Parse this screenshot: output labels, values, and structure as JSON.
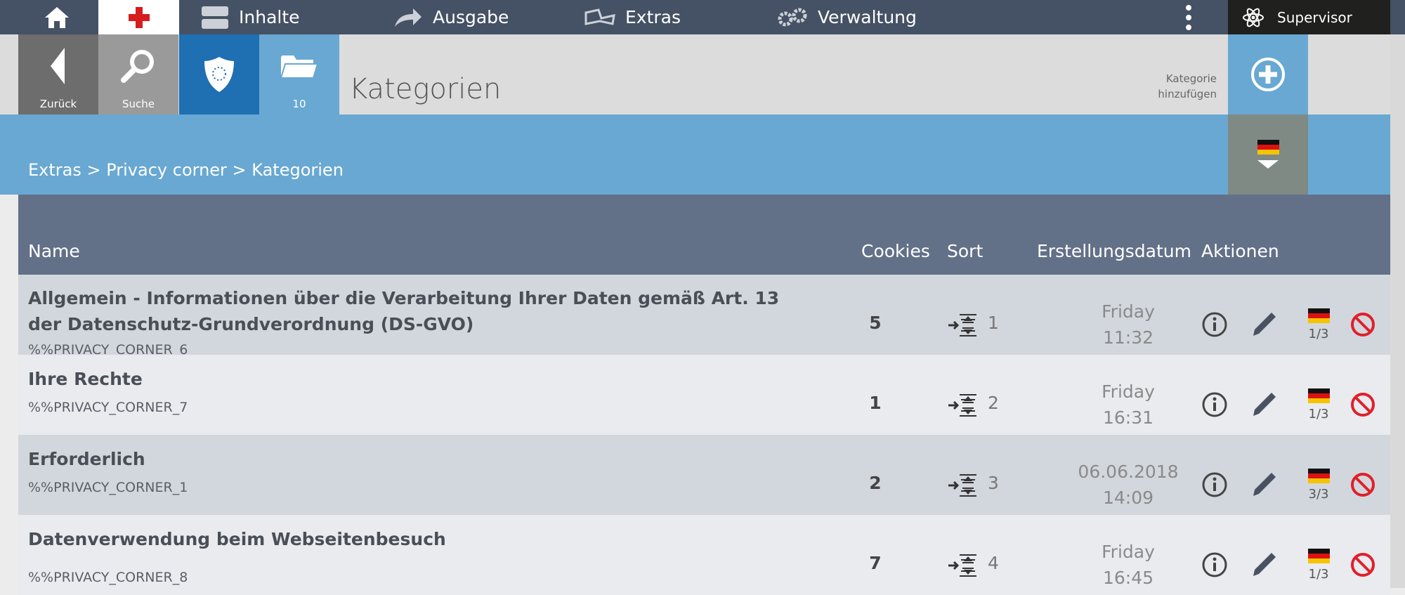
{
  "nav": {
    "items": [
      {
        "label": "Inhalte"
      },
      {
        "label": "Ausgabe"
      },
      {
        "label": "Extras"
      },
      {
        "label": "Verwaltung"
      }
    ],
    "user": "Supervisor"
  },
  "toolbar": {
    "back_label": "Zurück",
    "search_label": "Suche",
    "folder_count": "10",
    "page_title": "Kategorien",
    "add_label": "Kategorie hinzufügen"
  },
  "breadcrumb": "Extras > Privacy corner > Kategorien",
  "table": {
    "headers": {
      "name": "Name",
      "cookies": "Cookies",
      "sort": "Sort",
      "date": "Erstellungsdatum",
      "actions": "Aktionen"
    },
    "rows": [
      {
        "title": "Allgemein - Informationen über die Verarbeitung Ihrer Daten gemäß Art. 13 der Datenschutz-Grundverordnung (DS-GVO)",
        "key": "%%PRIVACY_CORNER_6",
        "cookies": "5",
        "sort": "1",
        "date_line1": "Friday",
        "date_line2": "11:32",
        "lang": "1/3"
      },
      {
        "title": "Ihre Rechte",
        "key": "%%PRIVACY_CORNER_7",
        "cookies": "1",
        "sort": "2",
        "date_line1": "Friday",
        "date_line2": "16:31",
        "lang": "1/3"
      },
      {
        "title": "Erforderlich",
        "key": "%%PRIVACY_CORNER_1",
        "cookies": "2",
        "sort": "3",
        "date_line1": "06.06.2018",
        "date_line2": "14:09",
        "lang": "3/3"
      },
      {
        "title": "Datenverwendung beim Webseitenbesuch",
        "key": "%%PRIVACY_CORNER_8",
        "cookies": "7",
        "sort": "4",
        "date_line1": "Friday",
        "date_line2": "16:45",
        "lang": "1/3"
      }
    ]
  },
  "colors": {
    "nav_bg": "#455164",
    "accent_blue": "#68a8d2",
    "dark_blue": "#1f6fb3",
    "table_header": "#627088",
    "delete_red": "#e0202a"
  },
  "icons": [
    "home-icon",
    "red-cross-icon",
    "content-icon",
    "share-icon",
    "extras-icon",
    "gears-icon",
    "more-icon",
    "atom-icon",
    "back-icon",
    "search-icon",
    "shield-icon",
    "folder-icon",
    "plus-circle-icon",
    "german-flag-icon",
    "chevron-down-icon",
    "sort-icon",
    "info-icon",
    "pencil-icon",
    "delete-icon"
  ]
}
